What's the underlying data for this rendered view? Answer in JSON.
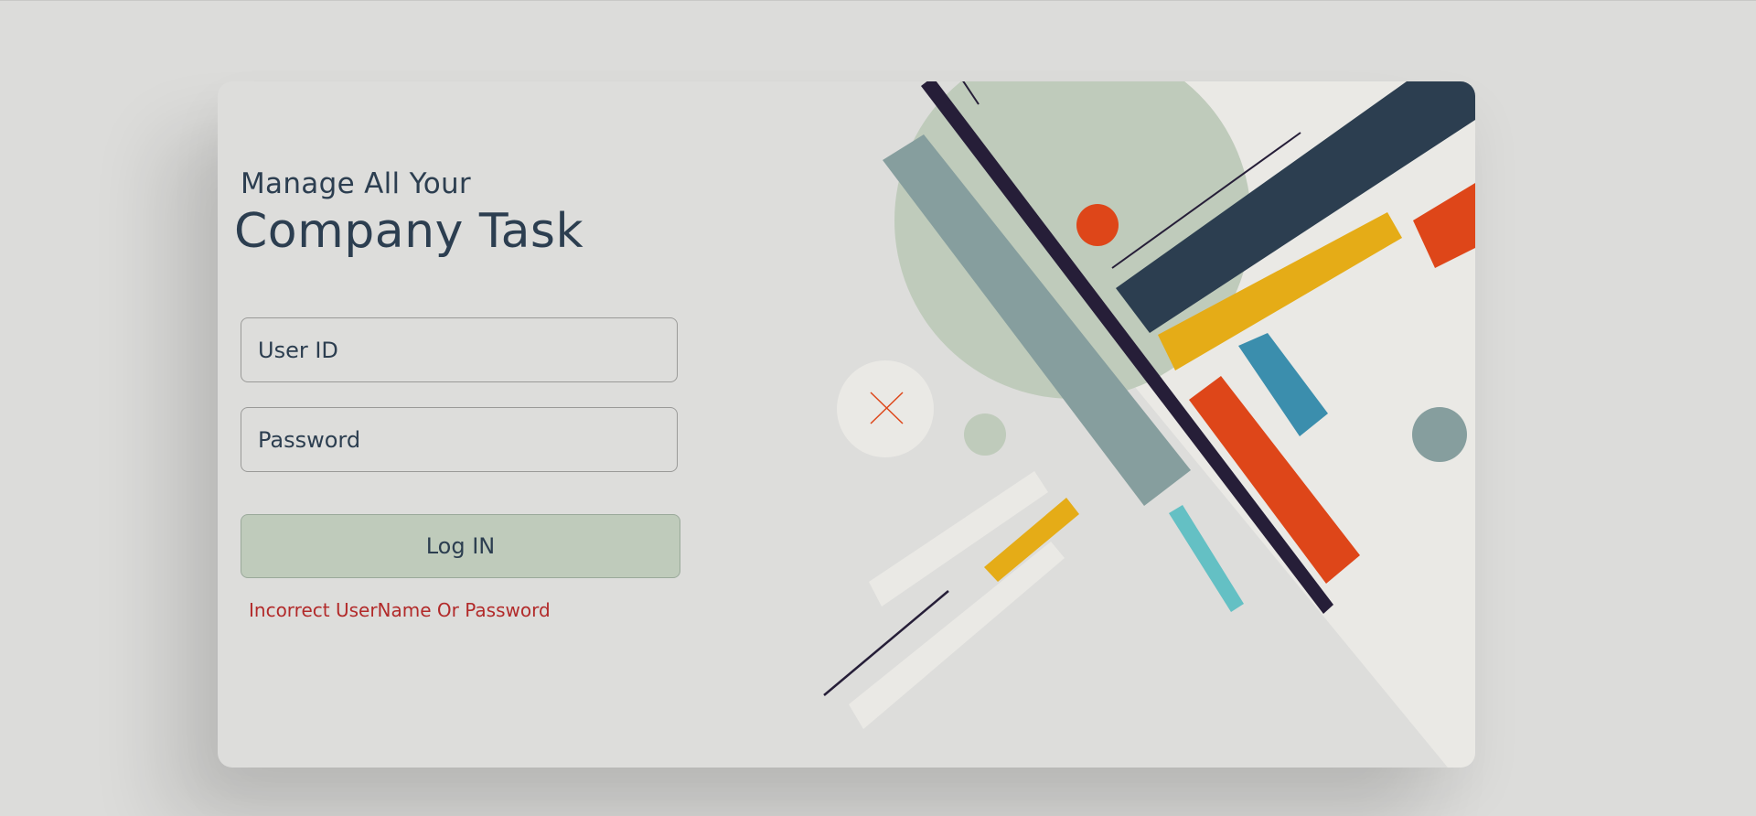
{
  "login": {
    "subtitle": "Manage All Your",
    "title": "Company Task",
    "userid_placeholder": "User ID",
    "password_placeholder": "Password",
    "login_label": "Log IN",
    "error_message": "Incorrect UserName Or Password"
  },
  "colors": {
    "navy": "#2c3e50",
    "sage": "#bfcbbb",
    "gray_teal": "#869e9e",
    "orange": "#de4619",
    "yellow": "#e5ac17",
    "blue": "#3b8ead",
    "cyan": "#64c0c4",
    "dark_purple": "#261e38",
    "light": "#eae9e5",
    "error": "#b22a2a"
  },
  "decor": {
    "close_icon": "close-icon"
  }
}
